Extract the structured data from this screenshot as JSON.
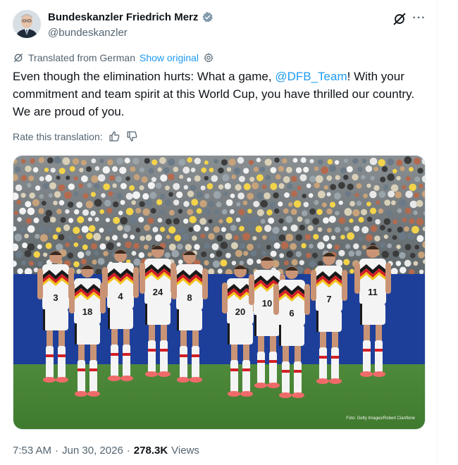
{
  "author": {
    "display_name": "Bundeskanzler Friedrich Merz",
    "handle": "@bundeskanzler",
    "verified_color": "#829aab"
  },
  "icons": {
    "grok": "grok-icon",
    "more": "more-icon",
    "translate": "translate-icon",
    "settings": "gear-icon",
    "thumbs_up": "thumbs-up-icon",
    "thumbs_down": "thumbs-down-icon"
  },
  "translation": {
    "notice": "Translated from German",
    "show_original": "Show original",
    "rate_label": "Rate this translation:"
  },
  "tweet": {
    "text_before": "Even though the elimination hurts: What a game, ",
    "mention": "@DFB_Team",
    "text_after": "! With your commitment and team spirit at this World Cup, you have thrilled our country. We are proud of you."
  },
  "media": {
    "photo_credit": "Foto: Getty Images/Robert Cianflone",
    "jersey_numbers": [
      "3",
      "18",
      "4",
      "24",
      "8",
      "20",
      "10",
      "6",
      "7",
      "11"
    ]
  },
  "meta": {
    "time": "7:53 AM",
    "date": "Jun 30, 2026",
    "views_count": "278.3K",
    "views_label": "Views"
  },
  "colors": {
    "accent": "#1d9bf0",
    "muted_text": "#536471",
    "text": "#0f1419"
  }
}
